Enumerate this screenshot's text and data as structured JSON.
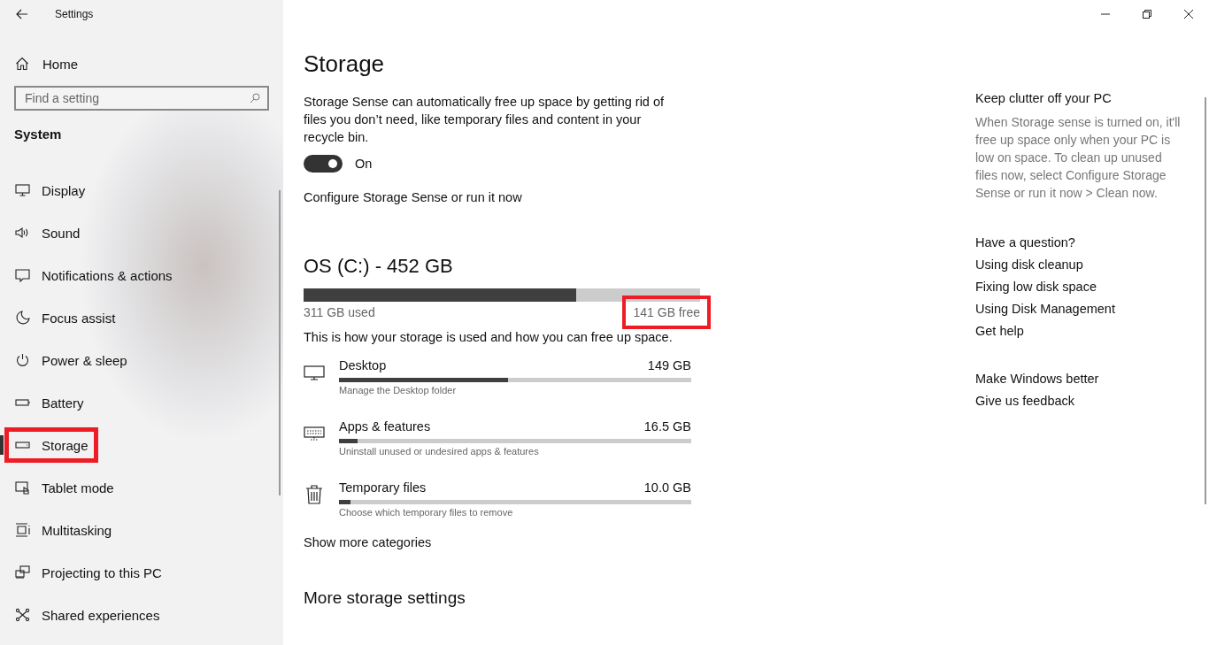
{
  "window": {
    "title": "Settings"
  },
  "sidebar": {
    "home": "Home",
    "search": {
      "placeholder": "Find a setting"
    },
    "section": "System",
    "items": [
      {
        "label": "Display",
        "kind": "display",
        "selected": false,
        "highlighted": false
      },
      {
        "label": "Sound",
        "kind": "sound",
        "selected": false,
        "highlighted": false
      },
      {
        "label": "Notifications & actions",
        "kind": "notifications",
        "selected": false,
        "highlighted": false
      },
      {
        "label": "Focus assist",
        "kind": "focus",
        "selected": false,
        "highlighted": false
      },
      {
        "label": "Power & sleep",
        "kind": "power",
        "selected": false,
        "highlighted": false
      },
      {
        "label": "Battery",
        "kind": "battery",
        "selected": false,
        "highlighted": false
      },
      {
        "label": "Storage",
        "kind": "storage",
        "selected": true,
        "highlighted": true
      },
      {
        "label": "Tablet mode",
        "kind": "tablet",
        "selected": false,
        "highlighted": false
      },
      {
        "label": "Multitasking",
        "kind": "multitasking",
        "selected": false,
        "highlighted": false
      },
      {
        "label": "Projecting to this PC",
        "kind": "projecting",
        "selected": false,
        "highlighted": false
      },
      {
        "label": "Shared experiences",
        "kind": "shared",
        "selected": false,
        "highlighted": false
      }
    ]
  },
  "main": {
    "title": "Storage",
    "description": "Storage Sense can automatically free up space by getting rid of files you don’t need, like temporary files and content in your recycle bin.",
    "toggle": {
      "on": true,
      "label": "On"
    },
    "configure_link": "Configure Storage Sense or run it now",
    "drive": {
      "title": "OS (C:) - 452 GB",
      "level": 0.688,
      "used": "311 GB used",
      "free": "141 GB free",
      "free_highlighted": true
    },
    "usage_text": "This is how your storage is used and how you can free up space.",
    "categories": [
      {
        "name": "Desktop",
        "size": "149 GB",
        "subtitle": "Manage the Desktop folder",
        "kind": "desktop",
        "level": 0.48
      },
      {
        "name": "Apps & features",
        "size": "16.5 GB",
        "subtitle": "Uninstall unused or undesired apps & features",
        "kind": "apps",
        "level": 0.052
      },
      {
        "name": "Temporary files",
        "size": "10.0 GB",
        "subtitle": "Choose which temporary files to remove",
        "kind": "trash",
        "level": 0.033
      }
    ],
    "show_more": "Show more categories",
    "more_settings": "More storage settings"
  },
  "aside": {
    "sections": [
      {
        "heading": "Keep clutter off your PC",
        "text": "When Storage sense is turned on, it'll free up space only when your PC is low on space. To clean up unused files now, select Configure Storage Sense or run it now > Clean now."
      },
      {
        "heading": "Have a question?",
        "links": [
          "Using disk cleanup",
          "Fixing low disk space",
          "Using Disk Management",
          "Get help"
        ]
      },
      {
        "heading": "Make Windows better",
        "links": [
          "Give us feedback"
        ]
      }
    ]
  }
}
